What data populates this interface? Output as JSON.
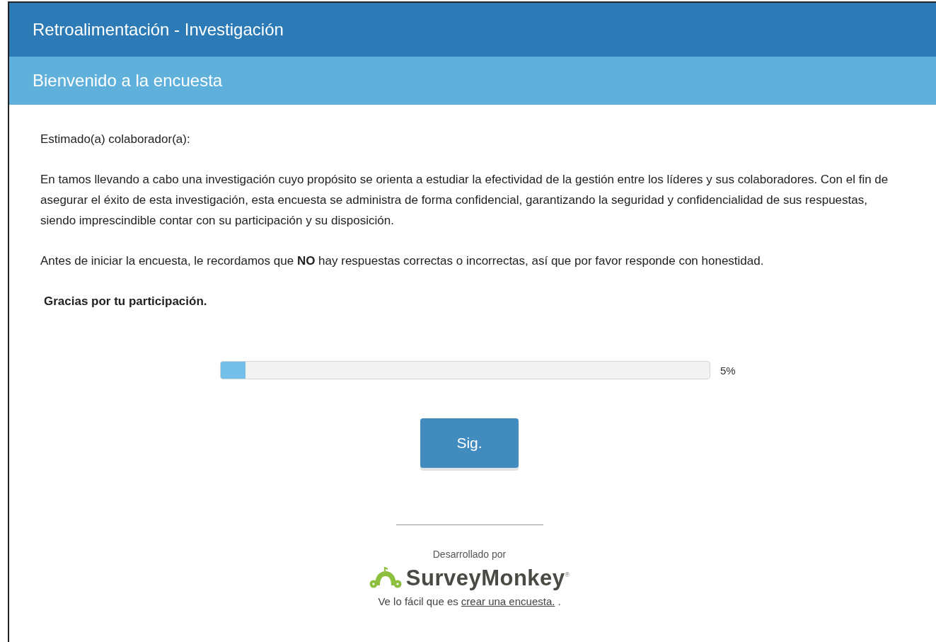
{
  "survey_title": "Retroalimentación - Investigación",
  "page_title": "Bienvenido a la encuesta",
  "greeting": "Estimado(a) colaborador(a):",
  "paragraphs": [
    "En tamos llevando a cabo una investigación cuyo propósito se orienta a estudiar la efectividad de la gestión entre los líderes y sus colaboradores. Con el fin de asegurar el éxito de esta investigación, esta encuesta se administra de forma confidencial, garantizando la seguridad y confidencialidad de sus respuestas, siendo imprescindible contar con su participación y su disposición.",
    "Antes de iniciar la encuesta, le recordamos que **NO** hay respuestas correctas o incorrectas, así que por favor responde con honestidad."
  ],
  "thanks": "Gracias por tu participación.",
  "progress": {
    "level": 0.05,
    "reading": "5%"
  },
  "next_button": "Sig.",
  "footer": {
    "powered_by": "Desarrollado por",
    "brand": "SurveyMonkey",
    "registered": "®",
    "tagline": "Ve lo fácil que es",
    "link": "crear una encuesta.",
    "trailing": "."
  }
}
